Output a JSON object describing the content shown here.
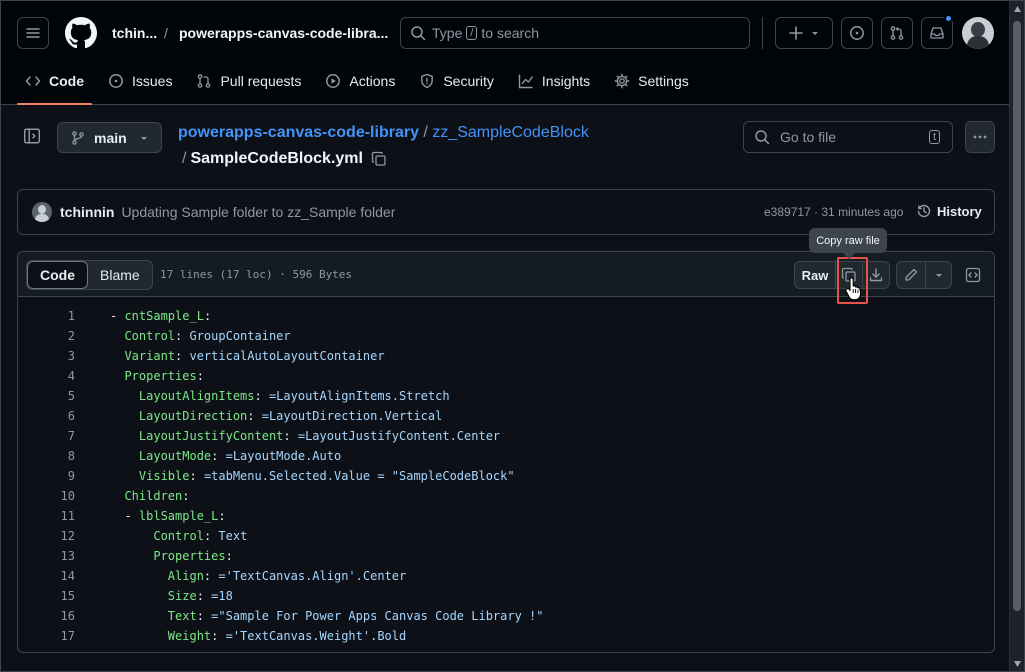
{
  "header": {
    "owner": "tchin...",
    "separator": "/",
    "repo": "powerapps-canvas-code-libra...",
    "search_prefix": "Type",
    "search_key": "/",
    "search_suffix": "to search"
  },
  "nav": {
    "tabs": [
      {
        "label": "Code",
        "icon": "code-icon",
        "active": true
      },
      {
        "label": "Issues",
        "icon": "issue-icon"
      },
      {
        "label": "Pull requests",
        "icon": "pull-request-icon"
      },
      {
        "label": "Actions",
        "icon": "play-icon"
      },
      {
        "label": "Security",
        "icon": "shield-icon"
      },
      {
        "label": "Insights",
        "icon": "graph-icon"
      },
      {
        "label": "Settings",
        "icon": "gear-icon"
      }
    ]
  },
  "repo_bar": {
    "branch": "main",
    "repo_link": "powerapps-canvas-code-library",
    "slash1": "/",
    "folder_link": "zz_SampleCodeBlock",
    "slash2": "/",
    "file_name": "SampleCodeBlock.yml",
    "go_to_file": "Go to file",
    "go_to_file_key": "t"
  },
  "commit": {
    "author": "tchinnin",
    "message": "Updating Sample folder to zz_Sample folder",
    "meta": "e389717 · 31 minutes ago",
    "history_label": "History"
  },
  "file": {
    "code_tab": "Code",
    "blame_tab": "Blame",
    "info": "17 lines (17 loc) · 596 Bytes",
    "raw_label": "Raw",
    "tooltip": "Copy raw file"
  },
  "colors": {
    "background": "#0d1117",
    "accent_underline": "#f78166",
    "link": "#4493f8",
    "yaml_key": "#7ee787",
    "yaml_value": "#a5d6ff",
    "highlight_border": "#e5534b"
  },
  "code_lines": [
    {
      "n": "1",
      "indent": "",
      "dash": "- ",
      "key": "cntSample_L",
      "val": ""
    },
    {
      "n": "2",
      "indent": "  ",
      "dash": "",
      "key": "Control",
      "val": "GroupContainer"
    },
    {
      "n": "3",
      "indent": "  ",
      "dash": "",
      "key": "Variant",
      "val": "verticalAutoLayoutContainer"
    },
    {
      "n": "4",
      "indent": "  ",
      "dash": "",
      "key": "Properties",
      "val": ""
    },
    {
      "n": "5",
      "indent": "    ",
      "dash": "",
      "key": "LayoutAlignItems",
      "val": "=LayoutAlignItems.Stretch"
    },
    {
      "n": "6",
      "indent": "    ",
      "dash": "",
      "key": "LayoutDirection",
      "val": "=LayoutDirection.Vertical"
    },
    {
      "n": "7",
      "indent": "    ",
      "dash": "",
      "key": "LayoutJustifyContent",
      "val": "=LayoutJustifyContent.Center"
    },
    {
      "n": "8",
      "indent": "    ",
      "dash": "",
      "key": "LayoutMode",
      "val": "=LayoutMode.Auto"
    },
    {
      "n": "9",
      "indent": "    ",
      "dash": "",
      "key": "Visible",
      "val": "=tabMenu.Selected.Value = \"SampleCodeBlock\""
    },
    {
      "n": "10",
      "indent": "  ",
      "dash": "",
      "key": "Children",
      "val": ""
    },
    {
      "n": "11",
      "indent": "  ",
      "dash": "- ",
      "key": "lblSample_L",
      "val": ""
    },
    {
      "n": "12",
      "indent": "      ",
      "dash": "",
      "key": "Control",
      "val": "Text"
    },
    {
      "n": "13",
      "indent": "      ",
      "dash": "",
      "key": "Properties",
      "val": ""
    },
    {
      "n": "14",
      "indent": "        ",
      "dash": "",
      "key": "Align",
      "val": "='TextCanvas.Align'.Center"
    },
    {
      "n": "15",
      "indent": "        ",
      "dash": "",
      "key": "Size",
      "val": "=18"
    },
    {
      "n": "16",
      "indent": "        ",
      "dash": "",
      "key": "Text",
      "val": "=\"Sample For Power Apps Canvas Code Library !\""
    },
    {
      "n": "17",
      "indent": "        ",
      "dash": "",
      "key": "Weight",
      "val": "='TextCanvas.Weight'.Bold"
    }
  ]
}
